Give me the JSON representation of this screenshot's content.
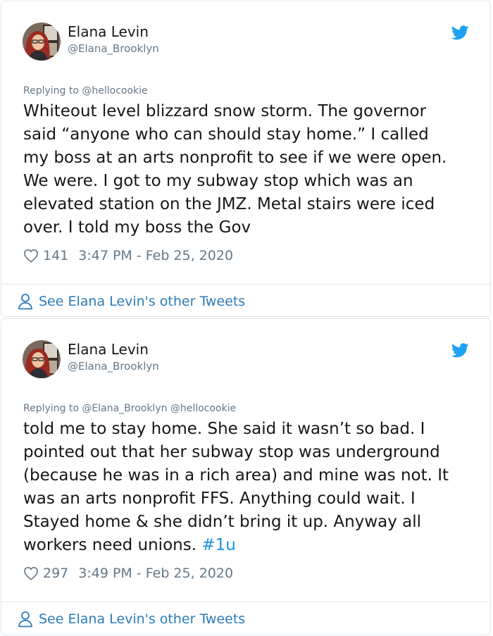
{
  "tweets": [
    {
      "author": {
        "name": "Elana Levin",
        "handle": "@Elana_Brooklyn"
      },
      "replying_to": "Replying to @hellocookie",
      "text": "Whiteout level blizzard snow storm. The governor\nsaid “anyone who can should stay home.” I called\nmy boss at an arts nonprofit to see if we were open.\nWe were. I got to my subway stop which was an\nelevated station on the JMZ. Metal stairs were iced\nover. I told my boss the Gov",
      "likes": "141",
      "timestamp": "3:47 PM - Feb 25, 2020",
      "see_more": "See Elana Levin's other Tweets"
    },
    {
      "author": {
        "name": "Elana Levin",
        "handle": "@Elana_Brooklyn"
      },
      "replying_to": "Replying to @Elana_Brooklyn @hellocookie",
      "text": "told me to stay home. She said it wasn’t so bad. I\npointed out that her subway stop was underground\n(because he was in a rich area) and mine was not. It\nwas an arts nonprofit FFS. Anything could wait. I\nStayed home & she didn’t bring it up.  Anyway all\nworkers need unions. ",
      "hashtag": "#1u",
      "likes": "297",
      "timestamp": "3:49 PM - Feb 25, 2020",
      "see_more": "See Elana Levin's other Tweets"
    }
  ],
  "icons": {
    "brand": "twitter-bird-icon",
    "like": "heart-outline-icon",
    "profile": "person-outline-icon"
  },
  "colors": {
    "twitter_blue": "#1da1f2",
    "link_blue": "#2b7bb9",
    "hashtag_blue": "#1b95e0",
    "secondary_text": "#657786",
    "border": "#e1e8ed"
  }
}
